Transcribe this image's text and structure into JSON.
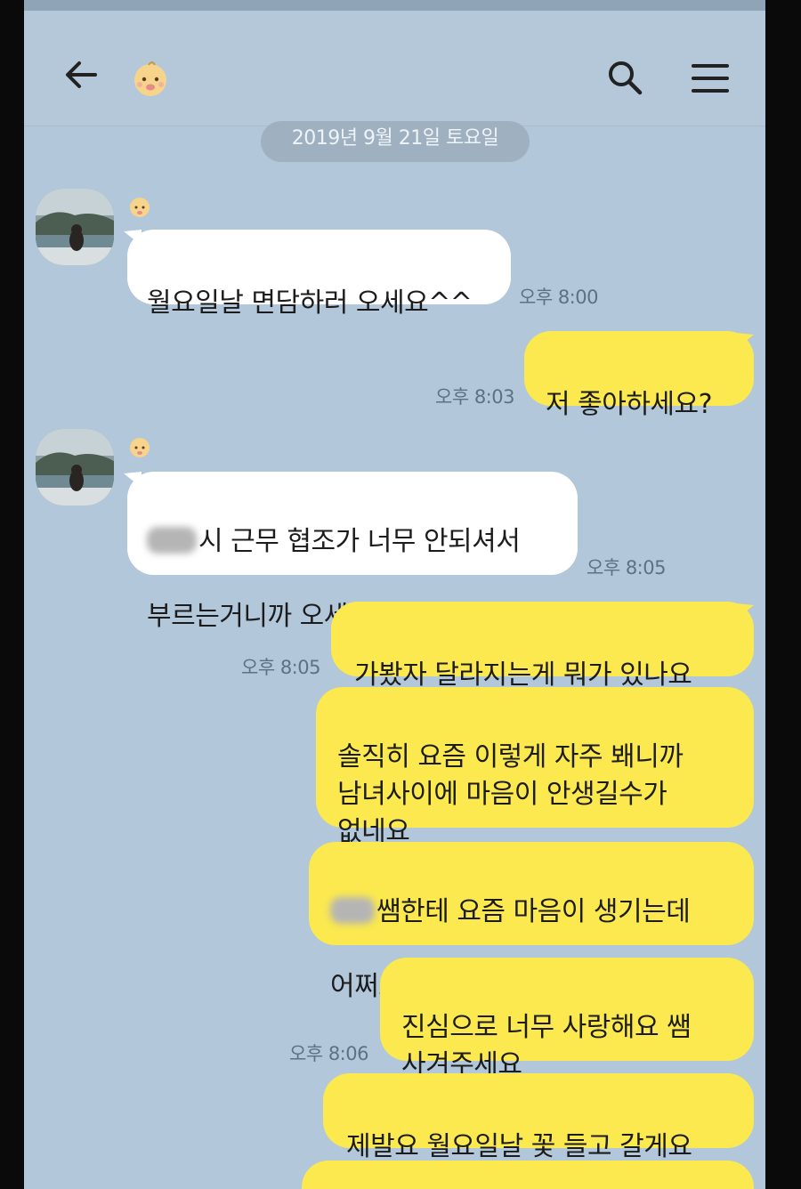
{
  "header": {
    "back_icon": "arrow-left-icon",
    "avatar_icon": "baby-face-icon",
    "search_icon": "search-icon",
    "menu_icon": "hamburger-menu-icon"
  },
  "date_divider": "2019년 9월 21일 토요일",
  "messages": [
    {
      "side": "in",
      "text": "월요일날 면담하러 오세요^^",
      "time": "오후 8:00"
    },
    {
      "side": "out",
      "text": "저 좋아하세요?",
      "time": "오후 8:03"
    },
    {
      "side": "in",
      "text_line1_suffix": "시 근무 협조가 너무 안되셔서",
      "text_line2": "부르는거니까 오세요~",
      "time": "오후 8:05"
    },
    {
      "side": "out",
      "text": "가봤자 달라지는게 뭐가 있나요",
      "time": "오후 8:05"
    },
    {
      "side": "out",
      "text": "솔직히 요즘 이렇게 자주 봬니까\n남녀사이에 마음이 안생길수가\n없네요"
    },
    {
      "side": "out",
      "text_line1_suffix": "쌤한테 요즘 마음이 생기는데",
      "text_line2": "어쩌죠 저랑 사겨주세요"
    },
    {
      "side": "out",
      "text": "진심으로 너무 사랑해요 쌤\n사겨주세요",
      "time": "오후 8:06"
    },
    {
      "side": "out",
      "text": "제발요 월요일날 꽃 들고 갈게요"
    }
  ],
  "colors": {
    "background": "#b2c7d9",
    "incoming_bubble": "#ffffff",
    "outgoing_bubble": "#fbe94f",
    "date_pill": "#9fb1c1",
    "time_text": "#5e7183"
  }
}
